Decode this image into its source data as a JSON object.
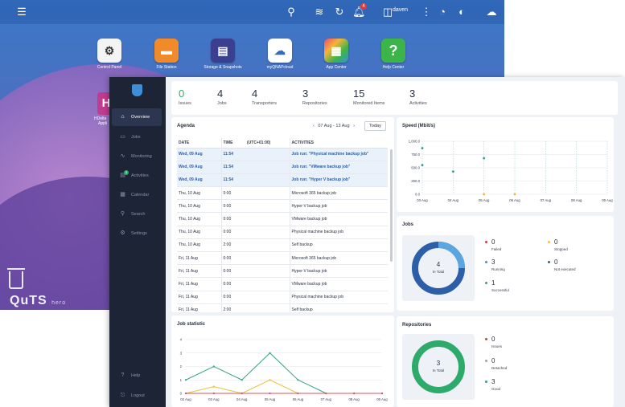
{
  "desktop": {
    "user": "daven",
    "notification_count": "4",
    "apps": [
      {
        "label": "Control Panel",
        "icon": "gear-icon",
        "color": "#f2f2f2"
      },
      {
        "label": "File Station",
        "icon": "folder-icon",
        "color": "#f08a2a"
      },
      {
        "label": "Storage & Snapshots",
        "icon": "storage-icon",
        "color": "#3b3f8f"
      },
      {
        "label": "myQNAPcloud",
        "icon": "cloud-icon",
        "color": "#ffffff"
      },
      {
        "label": "App Center",
        "icon": "grid-icon",
        "color": "#e84a6f"
      },
      {
        "label": "Help Center",
        "icon": "question-icon",
        "color": "#3bb54a"
      }
    ],
    "hd_letter": "H",
    "hd_label_1": "HDelta",
    "hd_label_2": "Appli",
    "logo_text": "QuTS",
    "logo_sub": "hero"
  },
  "sidebar": {
    "items": [
      {
        "label": "Overview",
        "icon": "home-icon"
      },
      {
        "label": "Jobs",
        "icon": "jobs-icon"
      },
      {
        "label": "Monitoring",
        "icon": "monitoring-icon"
      },
      {
        "label": "Activities",
        "icon": "activities-icon",
        "badge": "3"
      },
      {
        "label": "Calendar",
        "icon": "calendar-icon"
      },
      {
        "label": "Search",
        "icon": "search-icon"
      },
      {
        "label": "Settings",
        "icon": "settings-icon"
      }
    ],
    "help": "Help",
    "logout": "Logout"
  },
  "stats": [
    {
      "value": "0",
      "label": "Issues"
    },
    {
      "value": "4",
      "label": "Jobs"
    },
    {
      "value": "4",
      "label": "Transporters"
    },
    {
      "value": "3",
      "label": "Repositories"
    },
    {
      "value": "15",
      "label": "Monitored Items"
    },
    {
      "value": "3",
      "label": "Activities"
    }
  ],
  "agenda": {
    "title": "Agenda",
    "range": "07 Aug  -  13 Aug",
    "today": "Today",
    "headers": [
      "DATE",
      "TIME",
      "(UTC+01:00)",
      "ACTIVITIES"
    ],
    "rows": [
      {
        "date": "Wed, 09 Aug",
        "time": "11:54",
        "activity": "Job run: \"Physical machine backup job\""
      },
      {
        "date": "Wed, 09 Aug",
        "time": "11:54",
        "activity": "Job run: \"VMware backup job\""
      },
      {
        "date": "Wed, 09 Aug",
        "time": "11:54",
        "activity": "Job run: \"Hyper V backup job\""
      },
      {
        "date": "Thu, 10 Aug",
        "time": "0:00",
        "activity": "Microsoft 365 backup job"
      },
      {
        "date": "Thu, 10 Aug",
        "time": "0:00",
        "activity": "Hyper-V backup job"
      },
      {
        "date": "Thu, 10 Aug",
        "time": "0:00",
        "activity": "VMware backup job"
      },
      {
        "date": "Thu, 10 Aug",
        "time": "0:00",
        "activity": "Physical machine backup job"
      },
      {
        "date": "Thu, 10 Aug",
        "time": "2:00",
        "activity": "Self backup"
      },
      {
        "date": "Fri, 11 Aug",
        "time": "0:00",
        "activity": "Microsoft 365 backup job"
      },
      {
        "date": "Fri, 11 Aug",
        "time": "0:00",
        "activity": "Hyper-V backup job"
      },
      {
        "date": "Fri, 11 Aug",
        "time": "0:00",
        "activity": "VMware backup job"
      },
      {
        "date": "Fri, 11 Aug",
        "time": "0:00",
        "activity": "Physical machine backup job"
      },
      {
        "date": "Fri, 11 Aug",
        "time": "2:00",
        "activity": "Self backup"
      }
    ]
  },
  "speed": {
    "title": "Speed (Mbit/s)",
    "yticks": [
      "1,000.0",
      "750.0",
      "500.0",
      "250.0",
      "0.0"
    ],
    "xticks": [
      "03 Aug",
      "04 Aug",
      "05 Aug",
      "06 Aug",
      "07 Aug",
      "08 Aug",
      "09 Aug"
    ]
  },
  "jobs": {
    "title": "Jobs",
    "total": "4",
    "total_label": "In Total",
    "legend": [
      {
        "value": "0",
        "label": "Failed",
        "color": "#e53935"
      },
      {
        "value": "0",
        "label": "Stopped",
        "color": "#f2c230"
      },
      {
        "value": "3",
        "label": "Running",
        "color": "#3f8fd8"
      },
      {
        "value": "0",
        "label": "Not executed",
        "color": "#2c5fa8"
      },
      {
        "value": "1",
        "label": "Successful",
        "color": "#2eaa6a"
      }
    ]
  },
  "repositories": {
    "title": "Repositories",
    "total": "3",
    "total_label": "In Total",
    "legend": [
      {
        "value": "0",
        "label": "Issues",
        "color": "#e53935"
      },
      {
        "value": "0",
        "label": "Detached",
        "color": "#9aa0ad"
      },
      {
        "value": "3",
        "label": "Good",
        "color": "#2eaa6a"
      }
    ]
  },
  "job_statistic": {
    "title": "Job statistic",
    "yticks": [
      "4",
      "3",
      "2",
      "1",
      "0"
    ],
    "xticks": [
      "02 Aug",
      "03 Aug",
      "04 Aug",
      "05 Aug",
      "06 Aug",
      "07 Aug",
      "08 Aug",
      "09 Aug"
    ]
  },
  "chart_data": [
    {
      "type": "scatter",
      "title": "Speed (Mbit/s)",
      "ylim": [
        0,
        1000
      ],
      "categories": [
        "03 Aug",
        "04 Aug",
        "05 Aug",
        "06 Aug",
        "07 Aug",
        "08 Aug",
        "09 Aug"
      ],
      "series": [
        {
          "color": "#2e9e8f",
          "points": [
            [
              0,
              870
            ],
            [
              0,
              550
            ],
            [
              1,
              430
            ],
            [
              2,
              680
            ]
          ]
        },
        {
          "color": "#e8b92a",
          "points": [
            [
              2,
              0
            ],
            [
              3,
              0
            ]
          ]
        }
      ]
    },
    {
      "type": "line",
      "title": "Job statistic",
      "ylim": [
        0,
        4
      ],
      "categories": [
        "02 Aug",
        "03 Aug",
        "04 Aug",
        "05 Aug",
        "06 Aug",
        "07 Aug",
        "08 Aug",
        "09 Aug"
      ],
      "series": [
        {
          "color": "#3aa57a",
          "values": [
            1,
            2,
            1,
            3,
            1,
            0,
            0,
            0
          ]
        },
        {
          "color": "#e8c23a",
          "values": [
            0,
            0.5,
            0,
            1,
            0,
            0,
            0,
            0
          ]
        },
        {
          "color": "#e05060",
          "values": [
            0,
            0,
            0,
            0,
            0,
            0,
            0,
            0
          ]
        }
      ]
    }
  ]
}
